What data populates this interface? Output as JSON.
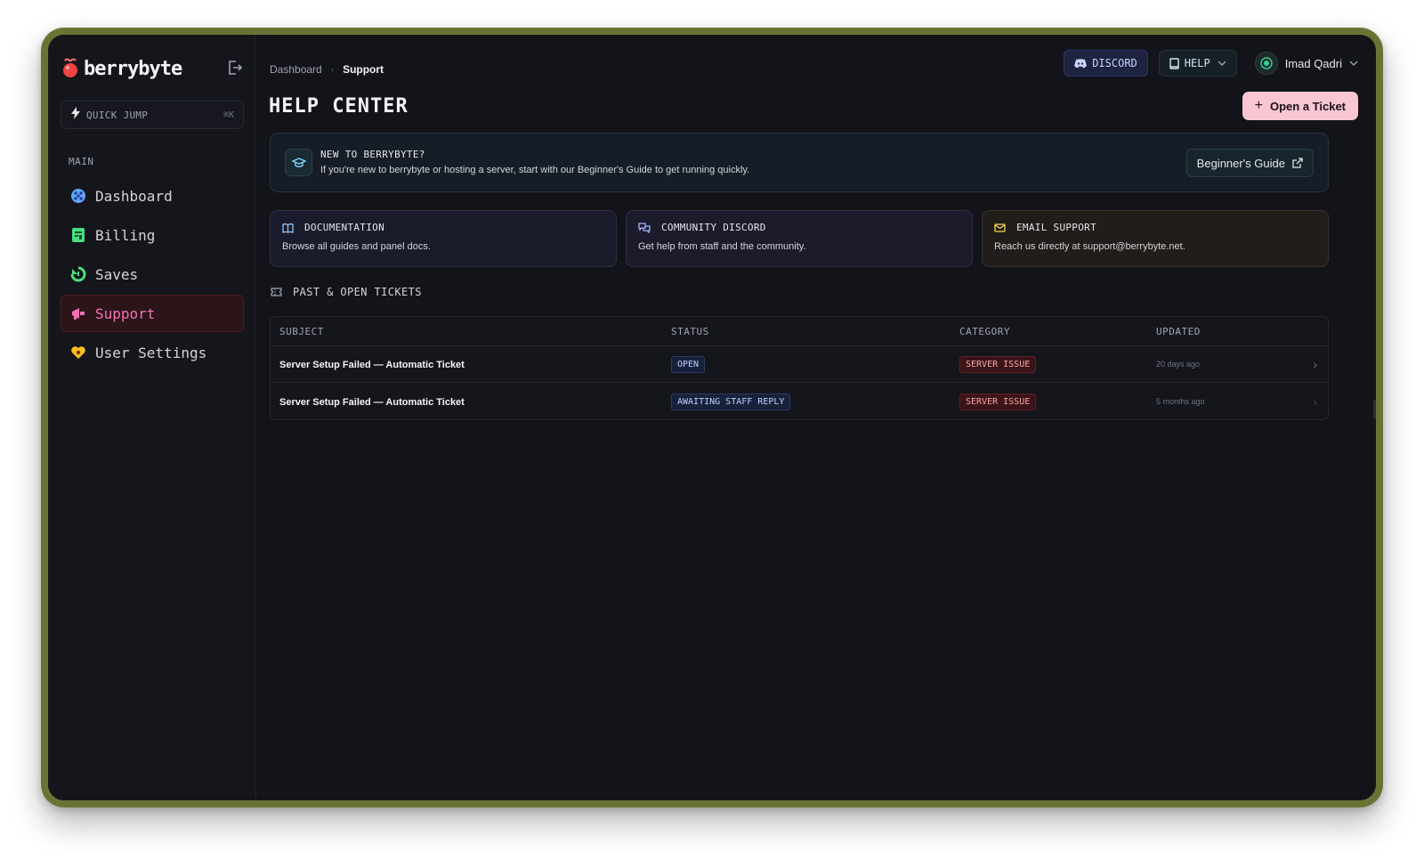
{
  "app": {
    "name": "berrybyte"
  },
  "sidebar": {
    "quick_jump": {
      "label": "QUICK JUMP",
      "shortcut": "⌘K"
    },
    "section_heading": "MAIN",
    "items": [
      {
        "label": "Dashboard",
        "icon": "dashboard-icon",
        "color": "#60a5fa"
      },
      {
        "label": "Billing",
        "icon": "billing-icon",
        "color": "#4ade80"
      },
      {
        "label": "Saves",
        "icon": "saves-icon",
        "color": "#4ade80"
      },
      {
        "label": "Support",
        "icon": "support-icon",
        "color": "#f472b6",
        "active": true
      },
      {
        "label": "User Settings",
        "icon": "user-settings-icon",
        "color": "#fbbf24"
      }
    ]
  },
  "header": {
    "breadcrumb": [
      "Dashboard",
      "Support"
    ],
    "discord_label": "DISCORD",
    "help_label": "HELP",
    "user_name": "Imad Qadri"
  },
  "page": {
    "title": "HELP CENTER",
    "open_ticket_label": "Open a Ticket"
  },
  "banner": {
    "title": "NEW TO BERRYBYTE?",
    "text": "If you're new to berrybyte or hosting a server, start with our Beginner's Guide to get running quickly.",
    "button_label": "Beginner's Guide"
  },
  "cards": [
    {
      "title": "DOCUMENTATION",
      "desc": "Browse all guides and panel docs.",
      "icon": "book-icon"
    },
    {
      "title": "COMMUNITY DISCORD",
      "desc": "Get help from staff and the community.",
      "icon": "chat-icon"
    },
    {
      "title": "EMAIL SUPPORT",
      "desc": "Reach us directly at support@berrybyte.net.",
      "icon": "mail-icon"
    }
  ],
  "tickets": {
    "heading": "PAST & OPEN TICKETS",
    "columns": [
      "SUBJECT",
      "STATUS",
      "CATEGORY",
      "UPDATED"
    ],
    "rows": [
      {
        "subject": "Server Setup Failed — Automatic Ticket",
        "status": "OPEN",
        "category": "SERVER ISSUE",
        "updated": "20 days ago"
      },
      {
        "subject": "Server Setup Failed — Automatic Ticket",
        "status": "AWAITING STAFF REPLY",
        "category": "SERVER ISSUE",
        "updated": "5 months ago"
      }
    ]
  },
  "colors": {
    "accent": "#f9c6d3",
    "background": "#13141a",
    "frame": "#6b7334",
    "active_nav": "#f472b6"
  }
}
